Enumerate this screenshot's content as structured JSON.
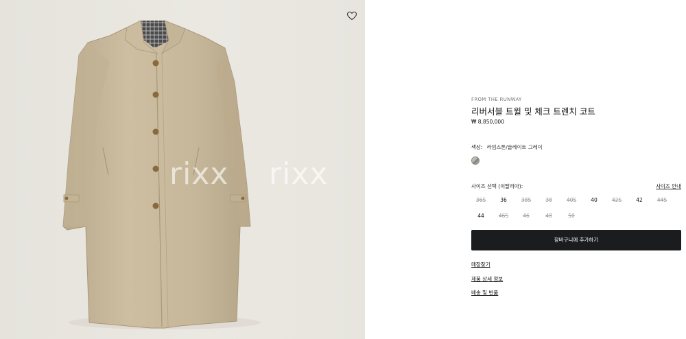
{
  "product_image": {
    "alt": "",
    "watermarks": [
      "rixx",
      "rixx"
    ],
    "wishlist_icon": "heart-outline-icon"
  },
  "product": {
    "eyebrow": "FROM THE RUNWAY",
    "title": "리버서블 트윌 및 체크 트렌치 코트",
    "price": "₩ 8,850,000"
  },
  "color": {
    "label": "색상:",
    "value": "라임스톤/슬레이트 그레이",
    "swatch_colors": [
      "#d8d2c4",
      "#7a7a78"
    ]
  },
  "sizes": {
    "label": "사이즈 선택 (이탈리아):",
    "guide_label": "사이즈 안내",
    "options": [
      {
        "label": "36S",
        "available": false
      },
      {
        "label": "36",
        "available": true
      },
      {
        "label": "38S",
        "available": false
      },
      {
        "label": "38",
        "available": false
      },
      {
        "label": "40S",
        "available": false
      },
      {
        "label": "40",
        "available": true
      },
      {
        "label": "42S",
        "available": false
      },
      {
        "label": "42",
        "available": true
      },
      {
        "label": "44S",
        "available": false
      },
      {
        "label": "44",
        "available": true
      },
      {
        "label": "46S",
        "available": false
      },
      {
        "label": "46",
        "available": false
      },
      {
        "label": "48",
        "available": false
      },
      {
        "label": "50",
        "available": false
      }
    ]
  },
  "actions": {
    "add_to_cart": "장바구니에 추가하기"
  },
  "links": {
    "store_finder": "매장찾기",
    "product_details": "제품 상세 정보",
    "shipping_returns": "배송 및 반품"
  },
  "colors": {
    "button_bg": "#1b1c1e",
    "page_bg": "#ffffff",
    "image_bg": "#e8e5df",
    "coat": "#c9b99c"
  }
}
